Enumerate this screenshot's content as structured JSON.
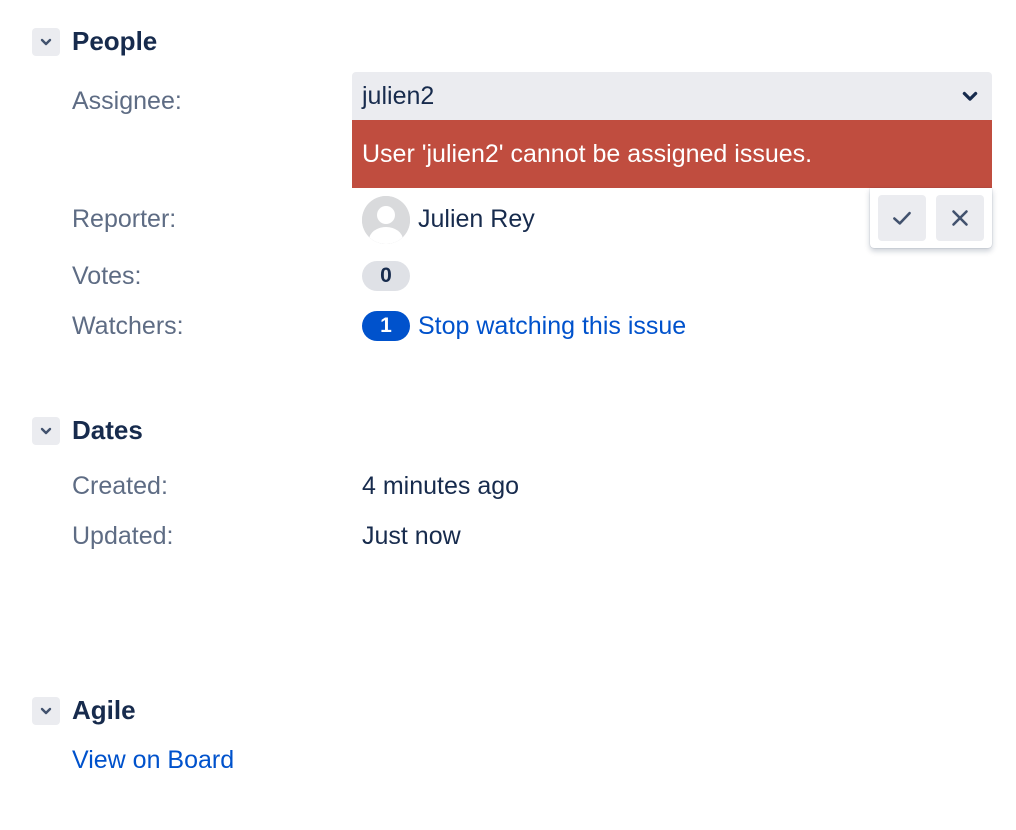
{
  "people": {
    "title": "People",
    "assignee": {
      "label": "Assignee:",
      "value": "julien2",
      "error": "User 'julien2' cannot be assigned issues."
    },
    "reporter": {
      "label": "Reporter:",
      "name": "Julien Rey"
    },
    "votes": {
      "label": "Votes:",
      "count": "0"
    },
    "watchers": {
      "label": "Watchers:",
      "count": "1",
      "link": "Stop watching this issue"
    }
  },
  "dates": {
    "title": "Dates",
    "created": {
      "label": "Created:",
      "value": "4 minutes ago"
    },
    "updated": {
      "label": "Updated:",
      "value": "Just now"
    }
  },
  "agile": {
    "title": "Agile",
    "link": "View on Board"
  },
  "icons": {
    "toggle": "chevron-down-icon",
    "confirm": "check-icon",
    "cancel": "close-icon",
    "avatar": "user-avatar-icon"
  },
  "colors": {
    "error_bg": "#c04d3f",
    "link": "#0052cc",
    "badge_blue": "#0052cc",
    "field_bg": "#ebecf0"
  }
}
